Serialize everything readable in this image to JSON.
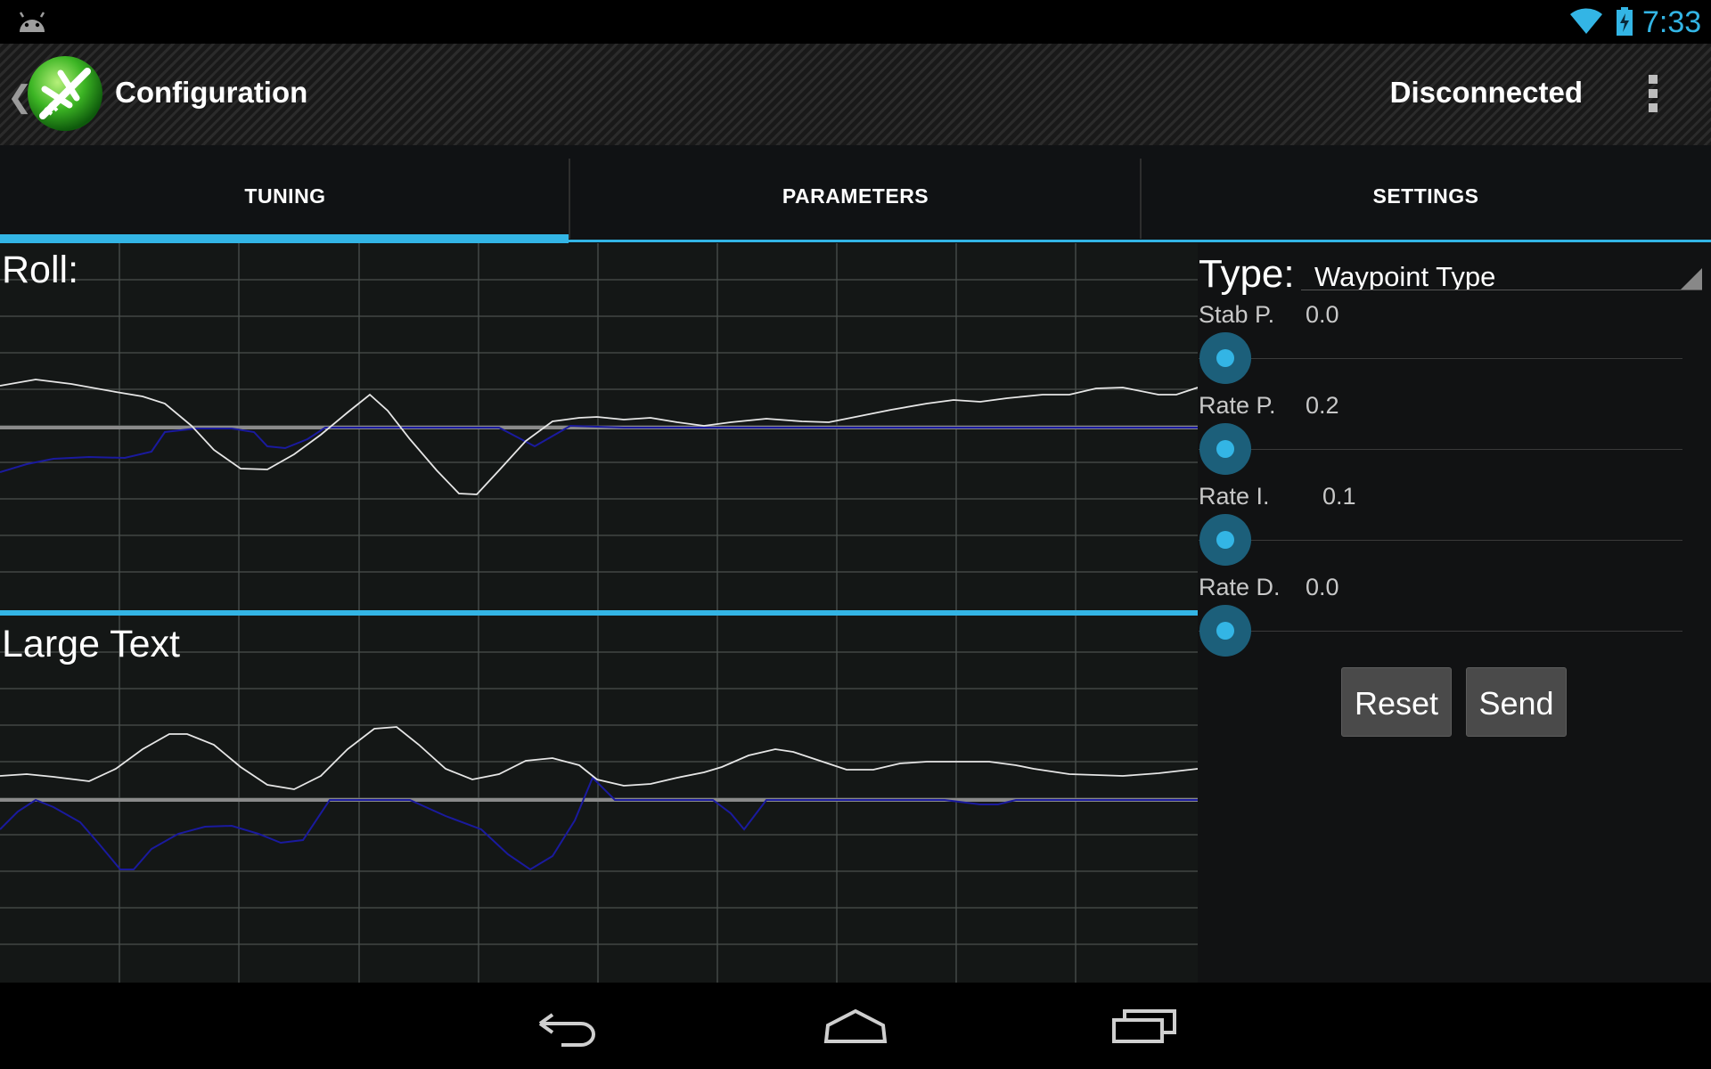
{
  "status_bar": {
    "time": "7:33",
    "icons": [
      "android-notification-icon",
      "wifi-icon",
      "battery-charging-icon"
    ],
    "accent_color": "#33b5e5"
  },
  "action_bar": {
    "title": "Configuration",
    "connection_status": "Disconnected",
    "icons": [
      "up-caret-icon",
      "airplane-logo-icon",
      "overflow-menu-icon"
    ]
  },
  "tabs": [
    {
      "label": "TUNING",
      "selected": true
    },
    {
      "label": "PARAMETERS",
      "selected": false
    },
    {
      "label": "SETTINGS",
      "selected": false
    }
  ],
  "graphs": {
    "top_label": "Roll:",
    "bottom_label": "Large Text",
    "line_colors": {
      "measured": "#e6e6e6",
      "target": "#1a1a9e",
      "reference": "#8a8a8a"
    }
  },
  "panel": {
    "type_label": "Type:",
    "type_value": "Waypoint Type",
    "params": [
      {
        "label": "Stab P.",
        "value": "0.0"
      },
      {
        "label": "Rate P.",
        "value": "0.2"
      },
      {
        "label": "Rate I.",
        "value": "0.1"
      },
      {
        "label": "Rate D.",
        "value": "0.0"
      }
    ],
    "reset_label": "Reset",
    "send_label": "Send"
  },
  "nav_bar": {
    "icons": [
      "back-icon",
      "home-icon",
      "recent-apps-icon"
    ]
  }
}
